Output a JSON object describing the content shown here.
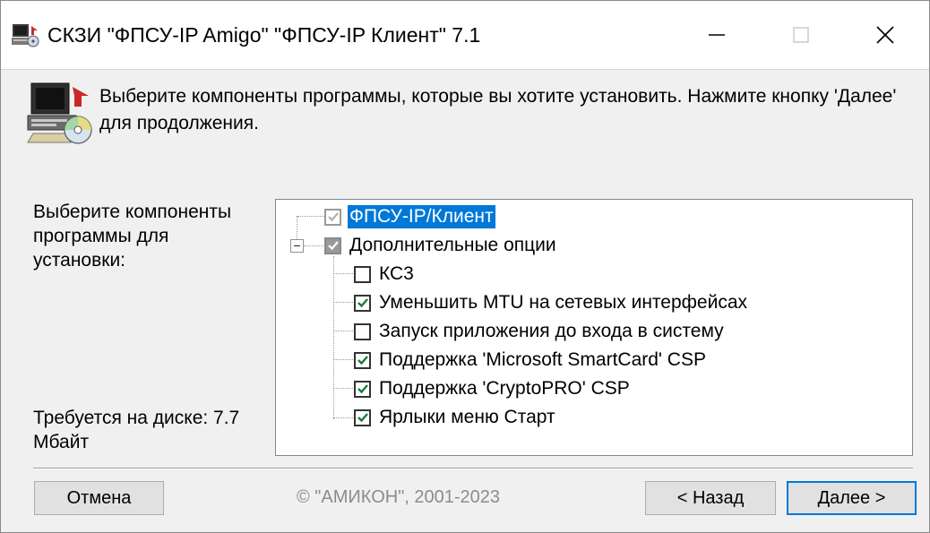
{
  "window": {
    "title": "СКЗИ \"ФПСУ-IP Amigo\" \"ФПСУ-IP Клиент\" 7.1",
    "icon": "installer-computer-icon",
    "controls": {
      "minimize": "minimize-icon",
      "maximize": "maximize-icon",
      "close": "close-icon"
    }
  },
  "header": {
    "icon": "computer-cd-install-icon",
    "text": "Выберите компоненты программы, которые вы хотите установить. Нажмите кнопку 'Далее' для продолжения."
  },
  "left": {
    "select_label": "Выберите компоненты программы для установки:",
    "disk_label": "Требуется на диске: 7.7 Мбайт"
  },
  "tree": {
    "items": [
      {
        "label": "ФПСУ-IP/Клиент",
        "state": "checked-disabled",
        "selected": true
      },
      {
        "label": "Дополнительные опции",
        "state": "partial",
        "expanded": true
      },
      {
        "label": "КС3",
        "state": "unchecked"
      },
      {
        "label": "Уменьшить MTU на сетевых интерфейсах",
        "state": "checked"
      },
      {
        "label": "Запуск приложения до входа в систему",
        "state": "unchecked"
      },
      {
        "label": "Поддержка 'Microsoft SmartCard' CSP",
        "state": "checked"
      },
      {
        "label": "Поддержка 'CryptoPRO' CSP",
        "state": "checked"
      },
      {
        "label": "Ярлыки меню Старт",
        "state": "checked"
      }
    ]
  },
  "footer": {
    "cancel": "Отмена",
    "copyright": "© \"АМИКОН\", 2001-2023",
    "back": "< Назад",
    "next": "Далее >"
  },
  "colors": {
    "selection": "#0078d7",
    "check": "#1a7a3a",
    "default_button_border": "#0078d7"
  }
}
